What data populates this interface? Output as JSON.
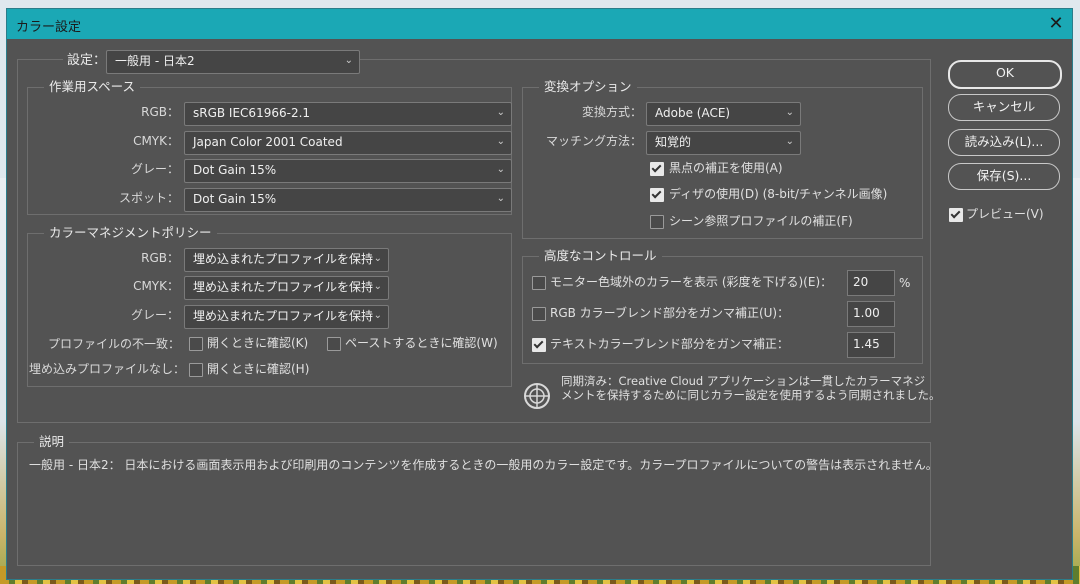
{
  "window": {
    "title": "カラー設定",
    "close": "✕"
  },
  "settings": {
    "label": "設定：",
    "value": "一般用 - 日本2"
  },
  "working_spaces": {
    "title": "作業用スペース",
    "rows": [
      {
        "label": "RGB：",
        "value": "sRGB IEC61966-2.1"
      },
      {
        "label": "CMYK：",
        "value": "Japan Color 2001 Coated"
      },
      {
        "label": "グレー：",
        "value": "Dot Gain 15%"
      },
      {
        "label": "スポット：",
        "value": "Dot Gain 15%"
      }
    ]
  },
  "color_management": {
    "title": "カラーマネジメントポリシー",
    "rows": [
      {
        "label": "RGB：",
        "value": "埋め込まれたプロファイルを保持"
      },
      {
        "label": "CMYK：",
        "value": "埋め込まれたプロファイルを保持"
      },
      {
        "label": "グレー：",
        "value": "埋め込まれたプロファイルを保持"
      }
    ],
    "mismatch_label": "プロファイルの不一致：",
    "mismatch_open": "開くときに確認(K)",
    "mismatch_paste": "ペーストするときに確認(W)",
    "missing_label": "埋め込みプロファイルなし：",
    "missing_open": "開くときに確認(H)"
  },
  "conversion": {
    "title": "変換オプション",
    "engine_label": "変換方式：",
    "engine_value": "Adobe (ACE)",
    "intent_label": "マッチング方法：",
    "intent_value": "知覚的",
    "bpc": "黒点の補正を使用(A)",
    "dither": "ディザの使用(D) (8-bit/チャンネル画像)",
    "scene": "シーン参照プロファイルの補正(F)"
  },
  "advanced": {
    "title": "高度なコントロール",
    "desaturate": "モニター色域外のカラーを表示 (彩度を下げる)(E)：",
    "desaturate_value": "20",
    "desaturate_unit": "%",
    "blend_rgb": "RGB カラーブレンド部分をガンマ補正(U)：",
    "blend_rgb_value": "1.00",
    "blend_text": "テキストカラーブレンド部分をガンマ補正：",
    "blend_text_value": "1.45"
  },
  "sync": {
    "text1": "同期済み：Creative Cloud アプリケーションは一貫したカラーマネジ",
    "text2": "メントを保持するために同じカラー設定を使用するよう同期されました。"
  },
  "description": {
    "title": "説明",
    "text": "一般用 - 日本2： 日本における画面表示用および印刷用のコンテンツを作成するときの一般用のカラー設定です。カラープロファイルについての警告は表示されません。"
  },
  "buttons": {
    "ok": "OK",
    "cancel": "キャンセル",
    "load": "読み込み(L)...",
    "save": "保存(S)...",
    "preview": "プレビュー(V)"
  },
  "state": {
    "bpc": true,
    "dither": true,
    "scene": false,
    "desaturate": false,
    "blend_rgb": false,
    "blend_text": true,
    "preview": true,
    "mismatch_open": false,
    "mismatch_paste": false,
    "missing_open": false
  }
}
